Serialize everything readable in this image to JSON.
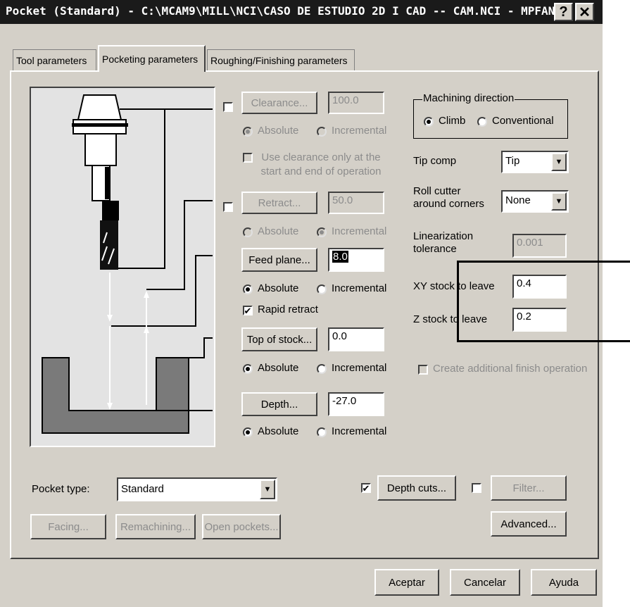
{
  "window": {
    "title": "Pocket (Standard) - C:\\MCAM9\\MILL\\NCI\\CASO DE ESTUDIO 2D  I  CAD  -- CAM.NCI - MPFAN",
    "help_label": "?",
    "close_label": "✕"
  },
  "tabs": [
    {
      "label": "Tool parameters"
    },
    {
      "label": "Pocketing parameters"
    },
    {
      "label": "Roughing/Finishing parameters"
    }
  ],
  "clearance": {
    "button": "Clearance...",
    "value": "100.0",
    "absolute": "Absolute",
    "incremental": "Incremental",
    "selected": "Absolute",
    "use_only_label": "Use clearance only at the start and end of operation"
  },
  "retract": {
    "button": "Retract...",
    "value": "50.0",
    "absolute": "Absolute",
    "incremental": "Incremental",
    "selected": "Incremental"
  },
  "feed_plane": {
    "button": "Feed plane...",
    "value": "8.0",
    "absolute": "Absolute",
    "incremental": "Incremental",
    "selected": "Absolute"
  },
  "rapid_retract": {
    "label": "Rapid retract",
    "checked": "✔"
  },
  "top_of_stock": {
    "button": "Top of stock...",
    "value": "0.0",
    "absolute": "Absolute",
    "incremental": "Incremental",
    "selected": "Absolute"
  },
  "depth": {
    "button": "Depth...",
    "value": "-27.0",
    "absolute": "Absolute",
    "incremental": "Incremental",
    "selected": "Absolute"
  },
  "machining_direction": {
    "title": "Machining direction",
    "climb": "Climb",
    "conventional": "Conventional",
    "selected": "Climb"
  },
  "tip_comp": {
    "label": "Tip comp",
    "value": "Tip"
  },
  "roll_cutter": {
    "label_line1": "Roll cutter",
    "label_line2": "around corners",
    "value": "None"
  },
  "linearization": {
    "label_line1": "Linearization",
    "label_line2": "tolerance",
    "value": "0.001"
  },
  "xy_stock": {
    "label": "XY stock to leave",
    "value": "0.4"
  },
  "z_stock": {
    "label": "Z stock to leave",
    "value": "0.2"
  },
  "additional_finish": {
    "label": "Create additional finish operation"
  },
  "pocket_type": {
    "label": "Pocket type:",
    "value": "Standard"
  },
  "depth_cuts": {
    "label": "Depth cuts...",
    "checked": "✔"
  },
  "filter": {
    "label": "Filter..."
  },
  "facing": {
    "label": "Facing..."
  },
  "remachining": {
    "label": "Remachining..."
  },
  "open_pockets": {
    "label": "Open pockets..."
  },
  "advanced": {
    "label": "Advanced..."
  },
  "footer": {
    "ok": "Aceptar",
    "cancel": "Cancelar",
    "help": "Ayuda"
  },
  "colors": {
    "title_bar": "#1a1a1a",
    "dialog_bg": "#d4d0c8",
    "disabled_text": "#8c8c8c",
    "picture_bg": "#e3e3e3",
    "part_fill": "#7a7a7a"
  }
}
